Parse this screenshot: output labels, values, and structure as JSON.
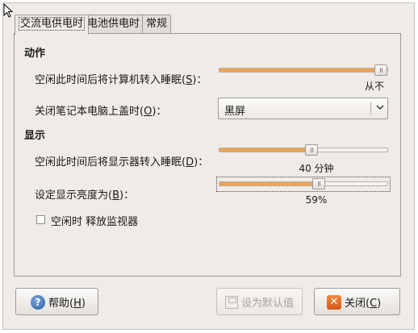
{
  "tabs": [
    {
      "label": "交流电供电时"
    },
    {
      "label": "电池供电时"
    },
    {
      "label": "常规"
    }
  ],
  "actions": {
    "title": "动作",
    "sleep_computer_label_pre": "空闲此时间后将计算机转入睡眠(",
    "sleep_computer_label_key": "S",
    "sleep_computer_label_post": ")：",
    "sleep_computer_value_fraction": 0.98,
    "sleep_computer_value_text": "从不",
    "lid_label_pre": "关闭笔记本电脑上盖时(",
    "lid_label_key": "O",
    "lid_label_post": ")：",
    "lid_selected": "黑屏"
  },
  "display": {
    "title": "显示",
    "sleep_display_label_pre": "空闲此时间后将显示器转入睡眠(",
    "sleep_display_label_key": "D",
    "sleep_display_label_post": ")：",
    "sleep_display_value_fraction": 0.55,
    "sleep_display_value_text": "40 分钟",
    "brightness_label_pre": "设定显示亮度为(",
    "brightness_label_key": "B",
    "brightness_label_post": ")：",
    "brightness_value_fraction": 0.59,
    "brightness_value_text": "59%",
    "dim_checkbox_label": "空闲时 释放监视器",
    "dim_checked": false
  },
  "buttons": {
    "help_pre": "帮助(",
    "help_key": "H",
    "help_post": ")",
    "make_default": "设为默认值",
    "close_pre": "关闭(",
    "close_key": "C",
    "close_post": ")"
  }
}
